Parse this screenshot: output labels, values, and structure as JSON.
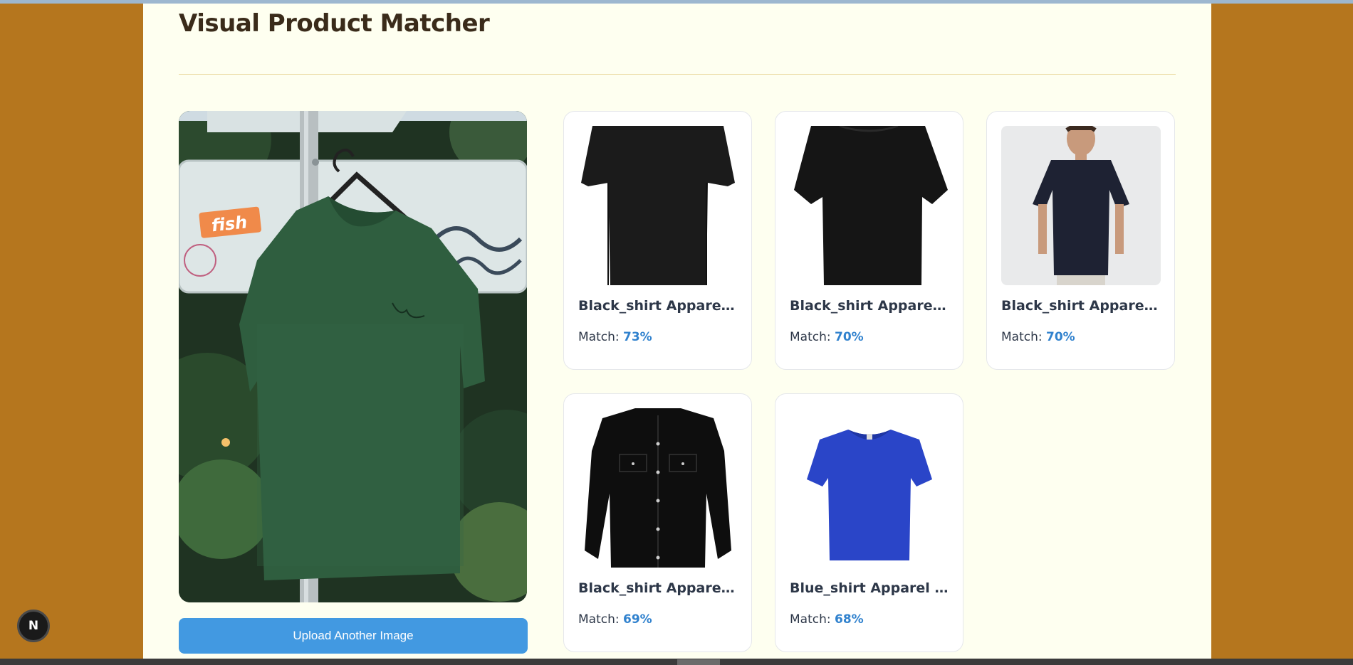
{
  "app": {
    "title": "Visual Product Matcher"
  },
  "query_image": {
    "alt": "Uploaded green t-shirt on hanger",
    "sticker_text": "fish"
  },
  "upload_button": {
    "label": "Upload Another Image"
  },
  "results": [
    {
      "name": "Black_shirt Apparel Item",
      "match_label": "Match:",
      "match": "73%"
    },
    {
      "name": "Black_shirt Apparel Item",
      "match_label": "Match:",
      "match": "70%"
    },
    {
      "name": "Black_shirt Apparel Item",
      "match_label": "Match:",
      "match": "70%"
    },
    {
      "name": "Black_shirt Apparel Item",
      "match_label": "Match:",
      "match": "69%"
    },
    {
      "name": "Blue_shirt Apparel Item",
      "match_label": "Match:",
      "match": "68%"
    }
  ],
  "dev_badge": {
    "label": "N"
  },
  "colors": {
    "page_bg": "#b5761e",
    "panel_bg": "#fefff0",
    "accent": "#4299e1",
    "match_pct": "#3182ce"
  }
}
